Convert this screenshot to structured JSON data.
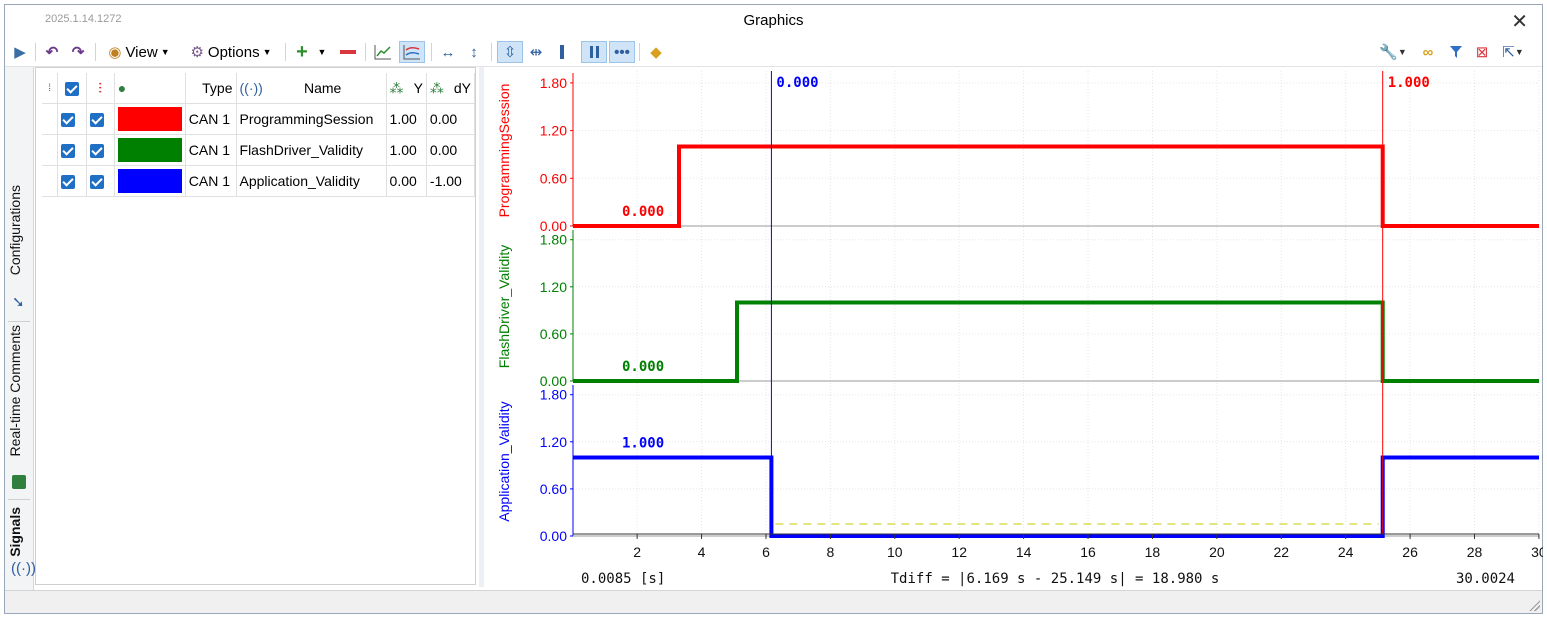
{
  "window": {
    "version": "2025.1.14.1272",
    "title": "Graphics",
    "close_glyph": "✕"
  },
  "toolbar": {
    "view_label": "View",
    "options_label": "Options"
  },
  "side_tabs": [
    "Configurations",
    "Real-time Comments",
    "Signals"
  ],
  "signal_table": {
    "headers": {
      "type": "Type",
      "name": "Name",
      "y": "Y",
      "dy": "dY"
    },
    "rows": [
      {
        "color": "#ff0000",
        "type": "CAN 1",
        "name": "ProgrammingSession",
        "y": "1.00",
        "dy": "0.00"
      },
      {
        "color": "#008000",
        "type": "CAN 1",
        "name": "FlashDriver_Validity",
        "y": "1.00",
        "dy": "0.00"
      },
      {
        "color": "#0000ff",
        "type": "CAN 1",
        "name": "Application_Validity",
        "y": "0.00",
        "dy": "-1.00"
      }
    ]
  },
  "chart_data": {
    "type": "line",
    "x_ticks": [
      2,
      4,
      6,
      8,
      10,
      12,
      14,
      16,
      18,
      20,
      22,
      24,
      26,
      28,
      30
    ],
    "xlim": [
      0.0085,
      30.0024
    ],
    "x_start_label": "0.0085 [s]",
    "x_end_label": "30.0024",
    "tdiff_label": "Tdiff = |6.169 s - 25.149 s| = 18.980 s",
    "cursors": [
      {
        "x": 6.169,
        "label": "0.000",
        "color": "#0000ff"
      },
      {
        "x": 25.149,
        "label": "1.000",
        "color": "#ff0000"
      }
    ],
    "series": [
      {
        "name": "ProgrammingSession",
        "color": "#ff0000",
        "y_ticks": [
          "1.80",
          "1.20",
          "0.60",
          "0.00"
        ],
        "ylim": [
          0,
          2
        ],
        "points": [
          [
            0.0085,
            0
          ],
          [
            3.3,
            0
          ],
          [
            3.3,
            1
          ],
          [
            25.149,
            1
          ],
          [
            25.149,
            0
          ],
          [
            30.0024,
            0
          ]
        ],
        "value_label": "0.000"
      },
      {
        "name": "FlashDriver_Validity",
        "color": "#008000",
        "y_ticks": [
          "1.80",
          "1.20",
          "0.60",
          "0.00"
        ],
        "ylim": [
          0,
          2
        ],
        "points": [
          [
            0.0085,
            0
          ],
          [
            5.1,
            0
          ],
          [
            5.1,
            1
          ],
          [
            25.149,
            1
          ],
          [
            25.149,
            0
          ],
          [
            30.0024,
            0
          ]
        ],
        "value_label": "0.000"
      },
      {
        "name": "Application_Validity",
        "color": "#0000ff",
        "y_ticks": [
          "1.80",
          "1.20",
          "0.60",
          "0.00"
        ],
        "ylim": [
          0,
          2
        ],
        "points": [
          [
            0.0085,
            1
          ],
          [
            6.169,
            1
          ],
          [
            6.169,
            0
          ],
          [
            25.149,
            0
          ],
          [
            25.149,
            1
          ],
          [
            30.0024,
            1
          ]
        ],
        "value_label": "1.000"
      }
    ]
  }
}
